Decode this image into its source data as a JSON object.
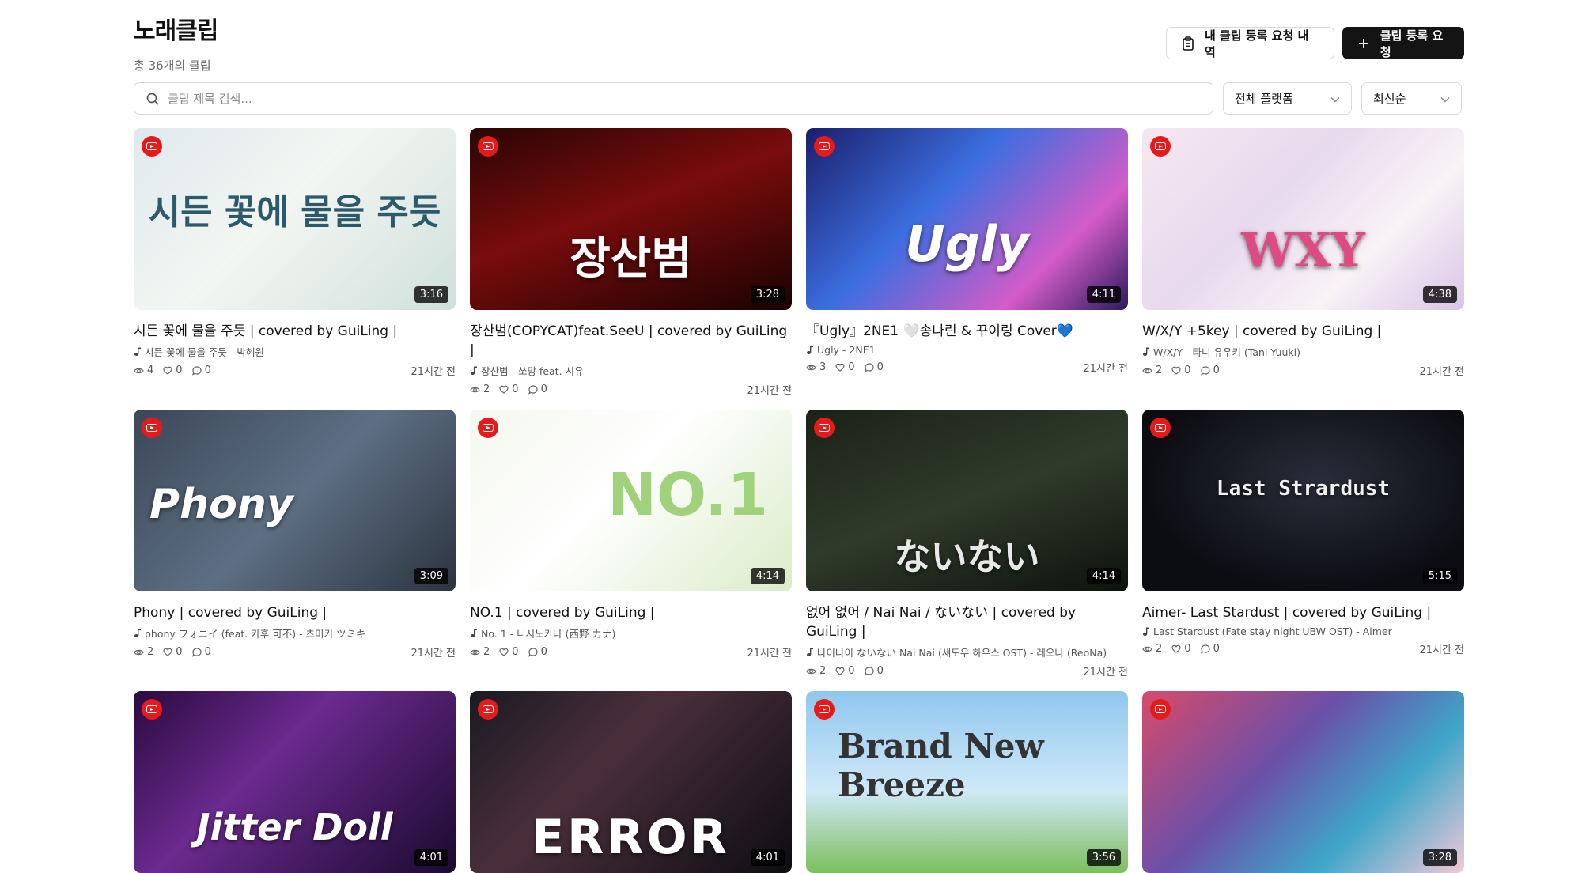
{
  "page": {
    "title": "노래클립",
    "count": "총 36개의 클립",
    "my_requests_label": "내 클립 등록 요청 내역",
    "register_label": "클립 등록 요청"
  },
  "filters": {
    "search_placeholder": "클립 제목 검색...",
    "platform": "전체 플랫폼",
    "sort": "최신순"
  },
  "colors": {
    "youtube_badge": "#e51b1b",
    "primary_button": "#141414"
  },
  "clips": [
    {
      "title": "시든 꽃에 물을 주듯 | covered by GuiLing |",
      "song": "시든 꽃에 물을 주듯 - 박혜원",
      "views": "4",
      "likes": "0",
      "comments": "0",
      "time": "21시간 전",
      "duration": "3:16",
      "art_text": "시든 꽃에 물을 주듯"
    },
    {
      "title": "장산범(COPYCAT)feat.SeeU | covered by GuiLing |",
      "song": "장산범 - 쏘망 feat. 시유",
      "views": "2",
      "likes": "0",
      "comments": "0",
      "time": "21시간 전",
      "duration": "3:28",
      "art_text": "장산범"
    },
    {
      "title": "『Ugly』2NE1 🤍송나린 & 꾸이링 Cover💙",
      "song": "Ugly - 2NE1",
      "views": "3",
      "likes": "0",
      "comments": "0",
      "time": "21시간 전",
      "duration": "4:11",
      "art_text": "Ugly"
    },
    {
      "title": "W/X/Y +5key | covered by GuiLing |",
      "song": "W/X/Y - 타니 유우키 (Tani Yuuki)",
      "views": "2",
      "likes": "0",
      "comments": "0",
      "time": "21시간 전",
      "duration": "4:38",
      "art_text": "WXY"
    },
    {
      "title": "Phony | covered by GuiLing |",
      "song": "phony フォニイ (feat. 카후 可不) - 츠미키 ツミキ",
      "views": "2",
      "likes": "0",
      "comments": "0",
      "time": "21시간 전",
      "duration": "3:09",
      "art_text": "Phony"
    },
    {
      "title": "NO.1 | covered by GuiLing |",
      "song": "No. 1 - 니시노카나 (西野 カナ)",
      "views": "2",
      "likes": "0",
      "comments": "0",
      "time": "21시간 전",
      "duration": "4:14",
      "art_text": "NO.1"
    },
    {
      "title": "없어 없어 / Nai Nai / ないない | covered by GuiLing |",
      "song": "나이나이 ないない Nai Nai (섀도우 하우스 OST) - 레오나 (ReoNa)",
      "views": "2",
      "likes": "0",
      "comments": "0",
      "time": "21시간 전",
      "duration": "4:14",
      "art_text": "ないない"
    },
    {
      "title": "Aimer- Last Stardust | covered by GuiLing |",
      "song": "Last Stardust (Fate stay night UBW OST) - Aimer",
      "views": "2",
      "likes": "0",
      "comments": "0",
      "time": "21시간 전",
      "duration": "5:15",
      "art_text": "Last Strardust"
    },
    {
      "title": "",
      "song": "",
      "views": "",
      "likes": "",
      "comments": "",
      "time": "",
      "duration": "4:01",
      "art_text": "Jitter Doll"
    },
    {
      "title": "",
      "song": "",
      "views": "",
      "likes": "",
      "comments": "",
      "time": "",
      "duration": "4:01",
      "art_text": "ERROR"
    },
    {
      "title": "",
      "song": "",
      "views": "",
      "likes": "",
      "comments": "",
      "time": "",
      "duration": "3:56",
      "art_text": "Brand New Breeze"
    },
    {
      "title": "",
      "song": "",
      "views": "",
      "likes": "",
      "comments": "",
      "time": "",
      "duration": "3:28",
      "art_text": ""
    }
  ]
}
